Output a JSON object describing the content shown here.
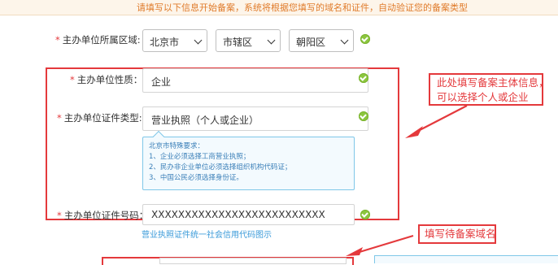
{
  "notice": "请填写以下信息开始备案，系统将根据您填写的域名和证件，自动验证您的备案类型",
  "rows": {
    "region": {
      "label": "主办单位所属区域:",
      "province": "北京市",
      "city": "市辖区",
      "district": "朝阳区"
    },
    "nature": {
      "label": "主办单位性质：",
      "value": "企业"
    },
    "cert_type": {
      "label": "主办单位证件类型:",
      "value": "营业执照（个人或企业）"
    },
    "cert_number": {
      "label": "主办单位证件号码：",
      "value": "XXXXXXXXXXXXXXXXXXXXXXXXXX"
    }
  },
  "required_mark": "*",
  "hint": {
    "title": "北京市特殊要求：",
    "items": [
      "1、企业必须选择工商营业执照；",
      "2、民办非企业单位必须选择组织机构代码证；",
      "3、中国公民必须选择身份证。"
    ]
  },
  "example_link": "营业执照证件统一社会信用代码图示",
  "annotations": {
    "subject": [
      "此处填写备案主体信息，",
      "可以选择个人或企业"
    ],
    "domain": "填写待备案域名"
  },
  "colors": {
    "annotation_red": "#e4393c",
    "valid_green": "#8cc63f",
    "hint_blue": "#3a7fb8",
    "notice_orange": "#e07b2a"
  },
  "icons": {
    "valid": "check-circle-icon",
    "dropdown": "chevron-down-icon"
  }
}
